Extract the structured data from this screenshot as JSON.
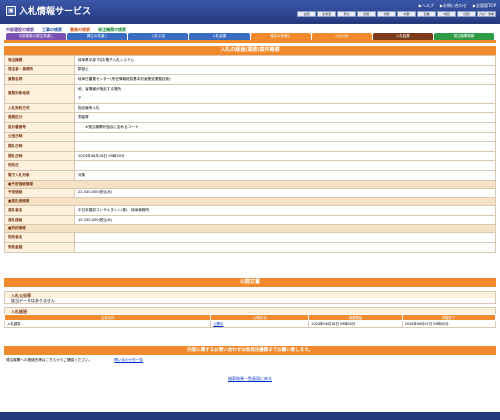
{
  "header": {
    "title": "入札情報サービス",
    "links": [
      "▶ヘルプ",
      "▶お問い合わせ",
      "▶全国版TOP"
    ],
    "regions": [
      "全国",
      "北海道",
      "東北",
      "関東",
      "北陸",
      "中部",
      "近畿",
      "中国",
      "四国",
      "九州・沖縄"
    ]
  },
  "categories": [
    {
      "label": "中部建設の検索",
      "color": "#6b3fa0"
    },
    {
      "label": "工事の検索",
      "color": "#1e5aa8"
    },
    {
      "label": "業務の検索",
      "color": "#d2571b"
    },
    {
      "label": "発注機関の検索",
      "color": "#1a8a3a"
    }
  ],
  "tabs": [
    {
      "label": "中部建設の発注見通し",
      "cls": "t-purple"
    },
    {
      "label": "発注の見通し",
      "cls": "t-blue"
    },
    {
      "label": "入札公告",
      "cls": "t-blue"
    },
    {
      "label": "入札結果",
      "cls": "t-blue"
    },
    {
      "label": "発注の見通し",
      "cls": "t-orange"
    },
    {
      "label": "入札公告",
      "cls": "t-orange"
    },
    {
      "label": "入札結果",
      "cls": "t-brown"
    },
    {
      "label": "発注機関情報",
      "cls": "t-green"
    }
  ],
  "detail": {
    "title": "入札の経過(業務)案件概要",
    "rows": [
      {
        "label": "発注機関",
        "value": "岐阜県中部 村井/電子入札システム",
        "kind": "row"
      },
      {
        "label": "発注者・事務所",
        "value": "郡部土",
        "kind": "row"
      },
      {
        "label": "業務名称",
        "value": "岐阜日農業センター(所在情報総覧基本計画策定業務技術)",
        "kind": "row"
      },
      {
        "label": "業務対象地域",
        "value": "他，省情報が指定する場所",
        "value2": "〒",
        "kind": "tall"
      },
      {
        "label": "入札契約方式",
        "value": "指名競争入札",
        "kind": "row"
      },
      {
        "label": "業務区分",
        "value": "測量等",
        "kind": "row"
      },
      {
        "label": "設計書番号",
        "value": "　　※発注機関が独自に定めるコード",
        "kind": "row"
      },
      {
        "label": "公告日時",
        "value": "",
        "kind": "row"
      },
      {
        "label": "開札日時",
        "value": "",
        "kind": "row"
      },
      {
        "label": "開札日時",
        "value": "2024年06月18日 09時30分",
        "kind": "row"
      },
      {
        "label": "契約日",
        "value": "",
        "kind": "row"
      },
      {
        "label": "電子入札対象",
        "value": "対象",
        "kind": "row"
      },
      {
        "label": "■予定価格情報",
        "value": "",
        "kind": "sub"
      },
      {
        "label": "予定価格",
        "value": "22,440,000(税込み)",
        "kind": "row"
      },
      {
        "label": "■落札者情報",
        "value": "",
        "kind": "sub"
      },
      {
        "label": "落札者名",
        "value": "中日本建設コンサルタント(株)　岐阜事務所",
        "kind": "row"
      },
      {
        "label": "落札価格",
        "value": "19,330,000(税込み)",
        "kind": "row"
      },
      {
        "label": "■契約情報",
        "value": "",
        "kind": "sub"
      },
      {
        "label": "契約者名",
        "value": "",
        "kind": "row"
      },
      {
        "label": "契約金額",
        "value": "",
        "kind": "row"
      }
    ]
  },
  "docs": {
    "title": "公開文書",
    "notice_head": "入札公告等",
    "notice_body": "該当データはありません",
    "result_head": "入札経過",
    "columns": [
      "文書名称",
      "公開状況",
      "掲載開始",
      "掲載終了"
    ],
    "rows": [
      {
        "name": "入札調書",
        "status": "公開中",
        "start": "2024年06月18日 09時00分",
        "end": "2026年06月01日 09時00分"
      }
    ]
  },
  "inquiry": {
    "bar": "内容に関するお問い合わせは各発注機関までお願い致します。",
    "text": "発注機関への連絡先等はこちらからご確認ください。",
    "link": "問い合わせ先一覧"
  },
  "back_link": "検索結果一覧画面に戻る",
  "colors": {
    "accent": "#f08a2c",
    "header": "#24397e"
  }
}
